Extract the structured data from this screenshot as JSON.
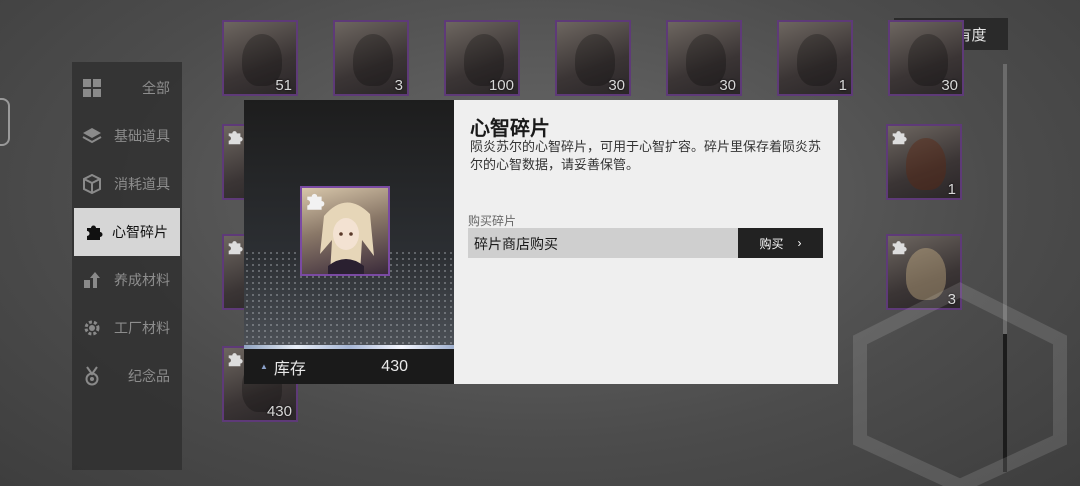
{
  "sort": {
    "label": "稀有度"
  },
  "sidebar": {
    "items": [
      {
        "label": "全部",
        "icon": "grid-icon",
        "active": false
      },
      {
        "label": "基础道具",
        "icon": "layers-icon",
        "active": false
      },
      {
        "label": "消耗道具",
        "icon": "cube-icon",
        "active": false
      },
      {
        "label": "心智碎片",
        "icon": "puzzle-icon",
        "active": true
      },
      {
        "label": "养成材料",
        "icon": "upgrade-icon",
        "active": false
      },
      {
        "label": "工厂材料",
        "icon": "gear-icon",
        "active": false
      },
      {
        "label": "纪念品",
        "icon": "medal-icon",
        "active": false
      }
    ]
  },
  "grid": {
    "row1_counts": [
      "51",
      "3",
      "100",
      "30",
      "30",
      "1",
      "30"
    ],
    "right_counts": [
      "1",
      "3"
    ],
    "bottom_left_count": "430"
  },
  "dialog": {
    "title": "心智碎片",
    "description": "陨炎苏尔的心智碎片，可用于心智扩容。碎片里保存着陨炎苏尔的心智数据，请妥善保管。",
    "buy_label": "购买碎片",
    "source": "碎片商店购买",
    "buy_button": "购买",
    "stock_label": "库存",
    "stock_value": "430"
  },
  "colors": {
    "rarity_frame": "#5e3a78",
    "accent_dark": "#222222",
    "panel_light": "#efefef"
  }
}
